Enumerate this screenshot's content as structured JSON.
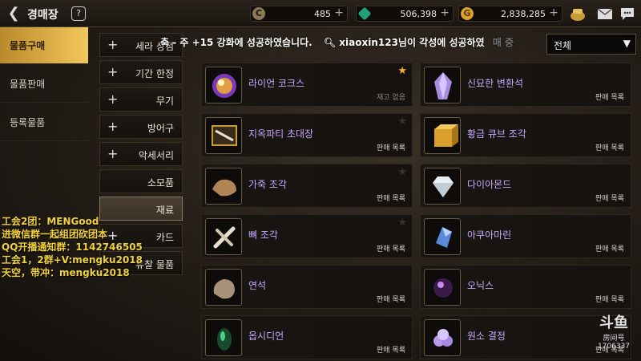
{
  "header": {
    "title": "경매장",
    "help_label": "?",
    "currencies": [
      {
        "icon": "coin-c-icon",
        "value": "485"
      },
      {
        "icon": "green-gem-icon",
        "value": "506,398"
      },
      {
        "icon": "gold-coin-icon",
        "value": "2,838,285"
      }
    ]
  },
  "categories": [
    {
      "label": "물품구매",
      "active": true
    },
    {
      "label": "물품판매",
      "active": false
    },
    {
      "label": "등록물품",
      "active": false
    }
  ],
  "subcategories": [
    {
      "label": "세라 상점",
      "has_plus": true
    },
    {
      "label": "기간 한정",
      "has_plus": true
    },
    {
      "label": "무기",
      "has_plus": true
    },
    {
      "label": "방어구",
      "has_plus": true
    },
    {
      "label": "악세서리",
      "has_plus": true
    },
    {
      "label": "소모품",
      "has_plus": false
    },
    {
      "label": "재료",
      "has_plus": false,
      "selected": true
    },
    {
      "label": "카드",
      "has_plus": true
    },
    {
      "label": "유찰 물품",
      "has_plus": false
    }
  ],
  "notice": {
    "left_text": "축 - 주 +15 강화에 성공하였습니다.",
    "right_text": "xiaoxin123님이 각성에 성공하였",
    "tail": "매 중"
  },
  "filter": {
    "value": "전체"
  },
  "items": [
    {
      "name": "라이언 코크스",
      "status": "재고 없음",
      "starred": true,
      "icon": "orb-icon"
    },
    {
      "name": "신묘한 변환석",
      "status": "판매 목록",
      "starred": false,
      "icon": "crystal-icon"
    },
    {
      "name": "지옥파티 초대장",
      "status": "판매 목록",
      "starred": false,
      "icon": "invitation-icon"
    },
    {
      "name": "황금 큐브 조각",
      "status": "판매 목록",
      "starred": false,
      "icon": "gold-cube-icon"
    },
    {
      "name": "가죽 조각",
      "status": "판매 목록",
      "starred": false,
      "icon": "leather-icon"
    },
    {
      "name": "다이아몬드",
      "status": "판매 목록",
      "starred": false,
      "icon": "diamond-icon"
    },
    {
      "name": "뼈 조각",
      "status": "판매 목록",
      "starred": false,
      "icon": "bone-icon"
    },
    {
      "name": "아쿠아마린",
      "status": "판매 목록",
      "starred": false,
      "icon": "aquamarine-icon"
    },
    {
      "name": "연석",
      "status": "판매 목록",
      "starred": false,
      "icon": "stone-icon"
    },
    {
      "name": "오닉스",
      "status": "판매 목록",
      "starred": false,
      "icon": "onyx-icon"
    },
    {
      "name": "옵시디언",
      "status": "판매 목록",
      "starred": false,
      "icon": "obsidian-icon"
    },
    {
      "name": "원소 결정",
      "status": "판매 목록",
      "starred": false,
      "icon": "element-crystal-icon"
    }
  ],
  "overlay": {
    "lines": [
      "工会2团：MENGood",
      "进微信群一起组团砍团本",
      "QQ开播通知群：1142746505",
      "工会1，2群+V:mengku2018",
      "天空，带冲：mengku2018"
    ]
  },
  "watermark": {
    "logo": "斗鱼",
    "line2": "房间号",
    "line3": "1706337"
  },
  "colors": {
    "accent": "#e3b54d",
    "item_name": "#c9a8ff",
    "overlay": "#f2d23a"
  }
}
